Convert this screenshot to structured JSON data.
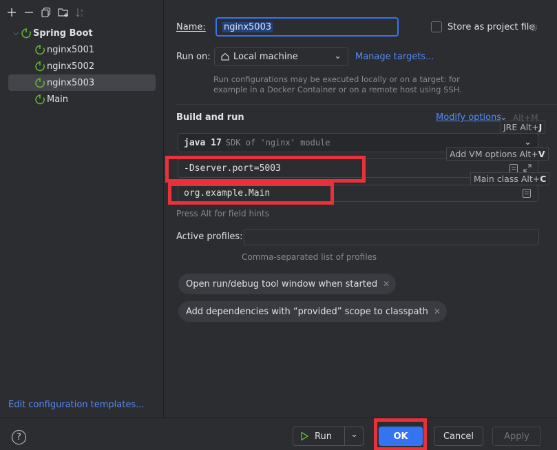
{
  "colors": {
    "accent": "#3574f0",
    "link": "#548af7",
    "highlight_box": "#e8313b",
    "background": "#2b2d30"
  },
  "toolbar": {
    "icons": [
      "add-icon",
      "remove-icon",
      "copy-icon",
      "new-folder-icon",
      "sort-icon"
    ]
  },
  "tree": {
    "group": "Spring Boot",
    "items": [
      {
        "label": "nginx5001",
        "selected": false
      },
      {
        "label": "nginx5002",
        "selected": false
      },
      {
        "label": "nginx5003",
        "selected": true
      },
      {
        "label": "Main",
        "selected": false
      }
    ]
  },
  "left_footer": {
    "edit_templates": "Edit configuration templates..."
  },
  "form": {
    "name_label": "Name:",
    "name_value": "nginx5003",
    "store_label": "Store as project file",
    "runon_label": "Run on:",
    "runon_value": "Local machine",
    "manage_targets": "Manage targets...",
    "runon_hint_1": "Run configurations may be executed locally or on a target: for",
    "runon_hint_2": "example in a Docker Container or on a remote host using SSH."
  },
  "build": {
    "title": "Build and run",
    "modify_options": "Modify options",
    "modify_shortcut": "Alt+M",
    "jre_tip": "JRE Alt+",
    "jre_tip_key": "J",
    "jre_value": "java 17",
    "jre_hint": "SDK of 'nginx' module",
    "vm_tip": "Add VM options Alt+",
    "vm_tip_key": "V",
    "vm_value": "-Dserver.port=5003",
    "main_tip": "Main class Alt+",
    "main_tip_key": "C",
    "main_value": "org.example.Main",
    "field_hint": "Press Alt for field hints",
    "profiles_label": "Active profiles:",
    "profiles_value": "",
    "profiles_hint": "Comma-separated list of profiles"
  },
  "chips": [
    {
      "label": "Open run/debug tool window when started"
    },
    {
      "label": "Add dependencies with “provided” scope to classpath"
    }
  ],
  "buttons": {
    "help": "?",
    "run": "Run",
    "ok": "OK",
    "cancel": "Cancel",
    "apply": "Apply"
  }
}
